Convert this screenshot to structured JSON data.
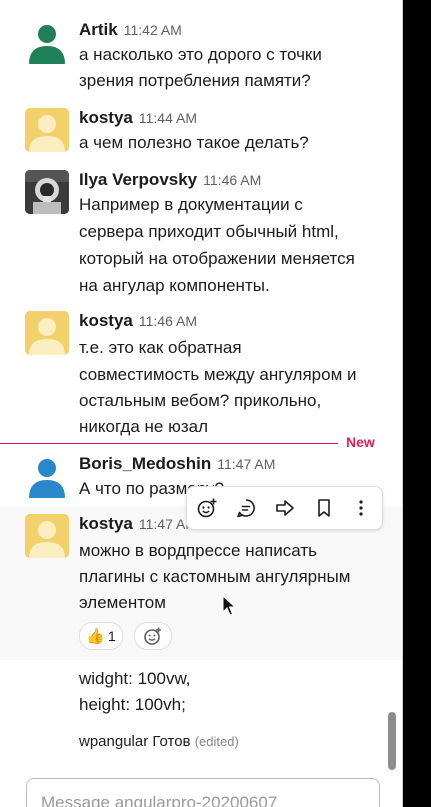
{
  "messages": [
    {
      "author": "Artik",
      "time": "11:42 AM",
      "avatar": "user-silhouette-icon",
      "avatar_color": "#1e7f59",
      "lines": [
        "а насколько это дорого с точки",
        "зрения потребления памяти?"
      ]
    },
    {
      "author": "kostya",
      "time": "11:44 AM",
      "avatar": "user-silhouette-icon",
      "avatar_color": "#f2d16b",
      "lines": [
        "а чем полезно такое делать?"
      ]
    },
    {
      "author": "Ilya Verpovsky",
      "time": "11:46 AM",
      "avatar": "astronaut-photo",
      "lines": [
        "Например в документации с",
        "сервера приходит обычный html,",
        "который на отображении меняется",
        "на ангулар компоненты."
      ]
    },
    {
      "author": "kostya",
      "time": "11:46 AM",
      "avatar": "user-silhouette-icon",
      "avatar_color": "#f2d16b",
      "lines": [
        "т.е. это как обратная",
        "совместимость между ангуляром и",
        "остальным вебом? прикольно,",
        "никогда не юзал"
      ]
    },
    {
      "author": "Boris_Medoshin",
      "time": "11:47 AM",
      "avatar": "user-silhouette-icon",
      "avatar_color": "#2a87c9",
      "lines": [
        "А что по размеру?"
      ]
    },
    {
      "author": "kostya",
      "time": "11:47 AM",
      "avatar": "user-silhouette-icon",
      "avatar_color": "#f2d16b",
      "lines": [
        "можно в вордпрессе написать",
        "плагины с кастомным ангулярным",
        "элементом"
      ]
    }
  ],
  "new_divider_label": "New",
  "reaction": {
    "emoji": "👍",
    "count": "1"
  },
  "code_lines": [
    "widght: 100vw,",
    "height: 100vh;"
  ],
  "status_line": {
    "text": "wpangular Готов",
    "edited": "(edited)"
  },
  "composer": {
    "placeholder": "Message angularpro-20200607"
  },
  "colors": {
    "accent_new": "#e01e5a"
  }
}
